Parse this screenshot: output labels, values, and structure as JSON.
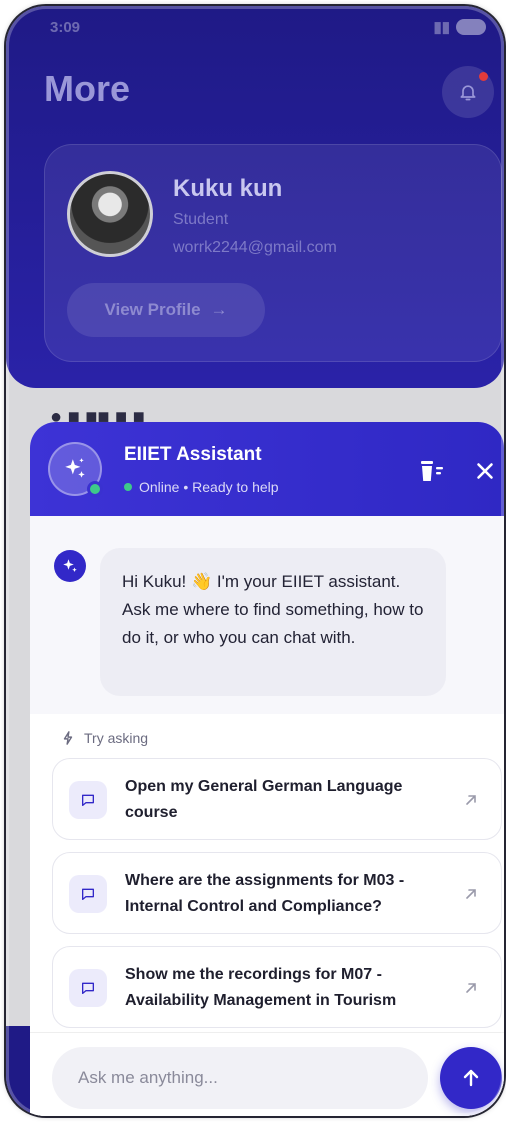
{
  "status_bar": {
    "time": "3:09"
  },
  "page": {
    "title": "More"
  },
  "profile": {
    "name": "Kuku kun",
    "role": "Student",
    "email": "worrk2244@gmail.com",
    "view_profile_label": "View Profile",
    "view_profile_arrow": "→"
  },
  "assistant": {
    "title": "EIIET Assistant",
    "status": "Online • Ready to help",
    "greeting": "Hi Kuku! 👋 I'm your EIIET assistant. Ask me where to find something, how to do it, or who you can chat with.",
    "try_label": "Try asking",
    "suggestions": [
      {
        "text": "Open my General German Language course"
      },
      {
        "text": "Where are the assignments for M03 - Internal Control and Compliance?"
      },
      {
        "text": "Show me the recordings for M07 - Availability Management in Tourism"
      }
    ],
    "input_placeholder": "Ask me anything..."
  },
  "colors": {
    "header_bg": "#1f1a86",
    "accent": "#3228c8",
    "online": "#3ec98a",
    "notification_dot": "#e23b3b"
  }
}
